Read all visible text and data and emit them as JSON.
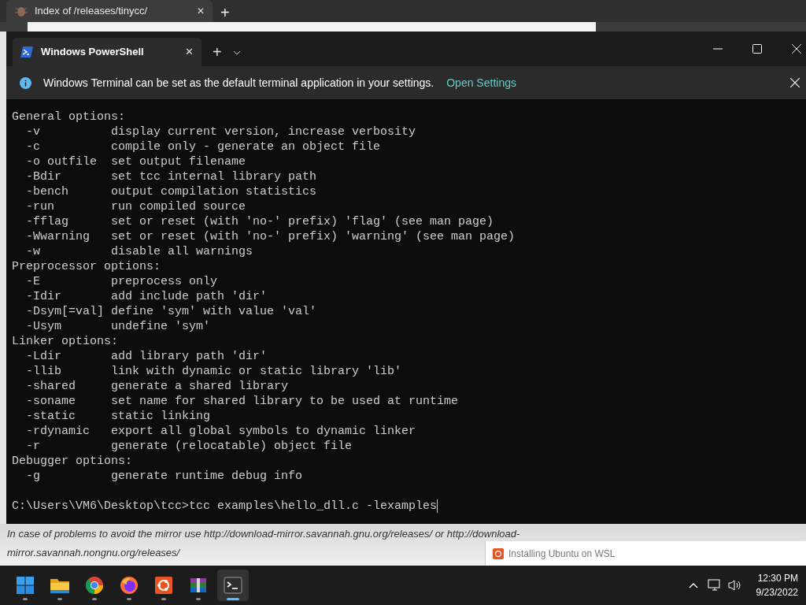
{
  "browser": {
    "tab": {
      "title": "Index of /releases/tinycc/",
      "close": "✕",
      "new": "+"
    }
  },
  "terminal": {
    "tab": {
      "title": "Windows PowerShell",
      "close": "✕"
    },
    "new_tab": "+",
    "info_bar": {
      "message": "Windows Terminal can be set as the default terminal application in your settings.",
      "link": "Open Settings"
    },
    "lines": [
      "General options:",
      "  -v          display current version, increase verbosity",
      "  -c          compile only - generate an object file",
      "  -o outfile  set output filename",
      "  -Bdir       set tcc internal library path",
      "  -bench      output compilation statistics",
      "  -run        run compiled source",
      "  -fflag      set or reset (with 'no-' prefix) 'flag' (see man page)",
      "  -Wwarning   set or reset (with 'no-' prefix) 'warning' (see man page)",
      "  -w          disable all warnings",
      "Preprocessor options:",
      "  -E          preprocess only",
      "  -Idir       add include path 'dir'",
      "  -Dsym[=val] define 'sym' with value 'val'",
      "  -Usym       undefine 'sym'",
      "Linker options:",
      "  -Ldir       add library path 'dir'",
      "  -llib       link with dynamic or static library 'lib'",
      "  -shared     generate a shared library",
      "  -soname     set name for shared library to be used at runtime",
      "  -static     static linking",
      "  -rdynamic   export all global symbols to dynamic linker",
      "  -r          generate (relocatable) object file",
      "Debugger options:",
      "  -g          generate runtime debug info"
    ],
    "prompt": "C:\\Users\\VM6\\Desktop\\tcc>tcc examples\\hello_dll.c -lexamples"
  },
  "page": {
    "lines": [
      "In case of problems to avoid the mirror use http://download-mirror.savannah.gnu.org/releases/ or http://download-",
      "mirror.savannah.nongnu.org/releases/"
    ]
  },
  "toast": {
    "text": "Installing Ubuntu on WSL"
  },
  "taskbar": {
    "apps": [
      {
        "kind": "start",
        "selected": false
      },
      {
        "kind": "folder",
        "selected": false
      },
      {
        "kind": "chrome",
        "selected": false
      },
      {
        "kind": "firefox",
        "selected": false
      },
      {
        "kind": "ubuntu",
        "selected": false
      },
      {
        "kind": "books",
        "selected": false
      },
      {
        "kind": "terminal",
        "selected": true
      }
    ],
    "time": "12:30 PM",
    "date": "9/23/2022"
  }
}
